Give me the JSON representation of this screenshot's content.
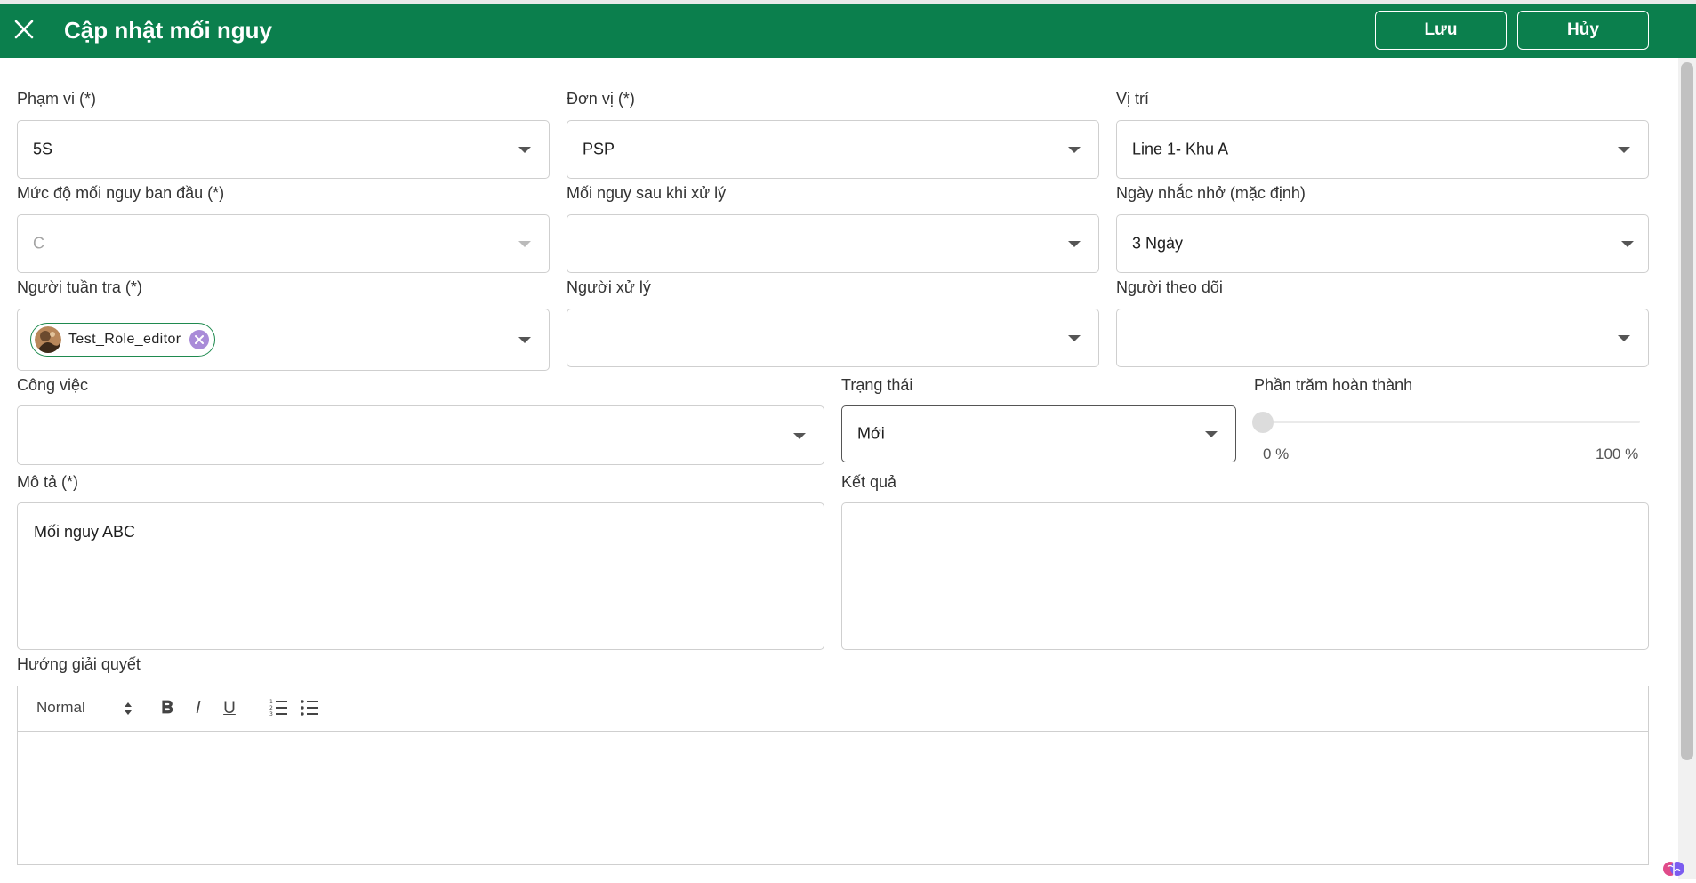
{
  "header": {
    "title": "Cập nhật mối nguy",
    "save_label": "Lưu",
    "cancel_label": "Hủy",
    "bg_color": "#0b7f4d"
  },
  "form": {
    "pham_vi": {
      "label": "Phạm vi (*)",
      "value": "5S"
    },
    "don_vi": {
      "label": "Đơn vị (*)",
      "value": "PSP"
    },
    "vi_tri": {
      "label": "Vị trí",
      "value": "Line 1- Khu A"
    },
    "muc_do": {
      "label": "Mức độ mối nguy ban đầu (*)",
      "value": "C"
    },
    "moi_nguy_sau": {
      "label": "Mối nguy sau khi xử lý",
      "value": ""
    },
    "ngay_nhac": {
      "label": "Ngày nhắc nhở (mặc định)",
      "value": "3 Ngày"
    },
    "nguoi_tuan_tra": {
      "label": "Người tuần tra (*)",
      "chip": "Test_Role_editor"
    },
    "nguoi_xu_ly": {
      "label": "Người xử lý",
      "value": ""
    },
    "nguoi_theo_doi": {
      "label": "Người theo dõi",
      "value": ""
    },
    "cong_viec": {
      "label": "Công việc",
      "value": ""
    },
    "trang_thai": {
      "label": "Trạng thái",
      "value": "Mới"
    },
    "phan_tram": {
      "label": "Phần trăm hoàn thành",
      "value": 0,
      "min_label": "0 %",
      "max_label": "100 %"
    },
    "mo_ta": {
      "label": "Mô tả (*)",
      "value": "Mối nguy ABC"
    },
    "ket_qua": {
      "label": "Kết quả",
      "value": ""
    },
    "huong_giai_quyet": {
      "label": "Hướng giải quyết",
      "format": "Normal"
    }
  },
  "icons": [
    "close-icon",
    "chevron-down-icon",
    "avatar",
    "remove-chip-icon",
    "bold-icon",
    "italic-icon",
    "underline-icon",
    "ordered-list-icon",
    "bullet-list-icon",
    "brain-icon"
  ]
}
